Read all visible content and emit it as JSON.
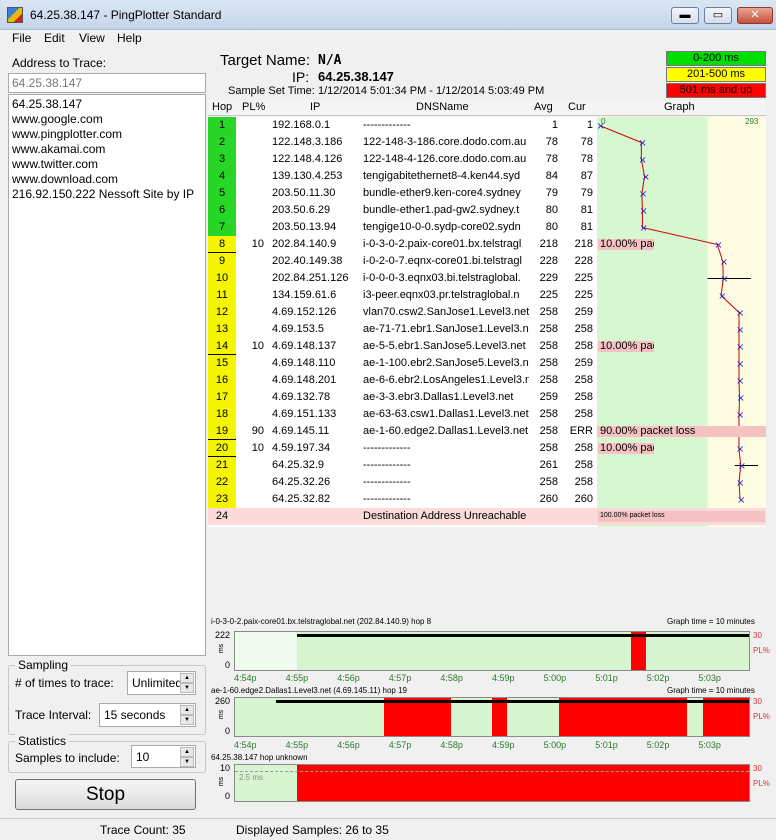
{
  "window": {
    "title": "64.25.38.147 - PingPlotter Standard",
    "minimize": "▬",
    "maximize": "▭",
    "close": "✕"
  },
  "menu": [
    "File",
    "Edit",
    "View",
    "Help"
  ],
  "address": {
    "label": "Address to Trace:",
    "input_value": "64.25.38.147",
    "list": [
      "64.25.38.147",
      "www.google.com",
      "www.pingplotter.com",
      "www.akamai.com",
      "www.twitter.com",
      "www.download.com",
      "216.92.150.222 Nessoft Site by IP"
    ]
  },
  "sampling": {
    "title": "Sampling",
    "times_label": "# of times to trace:",
    "times_value": "Unlimited",
    "interval_label": "Trace Interval:",
    "interval_value": "15 seconds"
  },
  "statistics": {
    "title": "Statistics",
    "samples_label": "Samples to include:",
    "samples_value": "10"
  },
  "stop_label": "Stop",
  "status": {
    "trace_count": "Trace Count: 35",
    "displayed": "Displayed Samples: 26 to 35"
  },
  "header": {
    "target_name_label": "Target Name:",
    "target_name": "N/A",
    "ip_label": "IP:",
    "ip": "64.25.38.147",
    "sample_label": "Sample Set Time:",
    "sample_value": "1/12/2014 5:01:34 PM - 1/12/2014 5:03:49 PM"
  },
  "legend": [
    {
      "label": "0-200 ms",
      "color": "#00dd00"
    },
    {
      "label": "201-500 ms",
      "color": "#ffff00"
    },
    {
      "label": "501 ms and up",
      "color": "#ff0000"
    }
  ],
  "columns": {
    "hop": "Hop",
    "pl": "PL%",
    "ip": "IP",
    "dns": "DNSName",
    "avg": "Avg",
    "cur": "Cur",
    "graph": "Graph"
  },
  "graph_scale": {
    "min": "0",
    "max": "293"
  },
  "colors": {
    "hop_green": "#27d627",
    "hop_yellow": "#f5f500",
    "graph_green": "#d6f7d0",
    "graph_yellow": "#fefde2",
    "loss_bar": "#f4c2c2"
  },
  "hops": [
    {
      "hop": "1",
      "pl": "",
      "ip": "192.168.0.1",
      "dns": "-------------",
      "avg": "1",
      "cur": "1",
      "color": "green"
    },
    {
      "hop": "2",
      "pl": "",
      "ip": "122.148.3.186",
      "dns": "122-148-3-186.core.dodo.com.au",
      "avg": "78",
      "cur": "78",
      "color": "green"
    },
    {
      "hop": "3",
      "pl": "",
      "ip": "122.148.4.126",
      "dns": "122-148-4-126.core.dodo.com.au",
      "avg": "78",
      "cur": "78",
      "color": "green"
    },
    {
      "hop": "4",
      "pl": "",
      "ip": "139.130.4.253",
      "dns": "tengigabitethernet8-4.ken44.syd",
      "avg": "84",
      "cur": "87",
      "color": "green"
    },
    {
      "hop": "5",
      "pl": "",
      "ip": "203.50.11.30",
      "dns": "bundle-ether9.ken-core4.sydney",
      "avg": "79",
      "cur": "79",
      "color": "green"
    },
    {
      "hop": "6",
      "pl": "",
      "ip": "203.50.6.29",
      "dns": "bundle-ether1.pad-gw2.sydney.t",
      "avg": "80",
      "cur": "81",
      "color": "green"
    },
    {
      "hop": "7",
      "pl": "",
      "ip": "203.50.13.94",
      "dns": "tengige10-0-0.sydp-core02.sydn",
      "avg": "80",
      "cur": "81",
      "color": "green"
    },
    {
      "hop": "8",
      "pl": "10",
      "ip": "202.84.140.9",
      "dns": "i-0-3-0-2.paix-core01.bx.telstragl",
      "avg": "218",
      "cur": "218",
      "color": "yellow",
      "loss": "10.00% packet loss"
    },
    {
      "hop": "9",
      "pl": "",
      "ip": "202.40.149.38",
      "dns": "i-0-2-0-7.eqnx-core01.bi.telstragl",
      "avg": "228",
      "cur": "228",
      "color": "yellow"
    },
    {
      "hop": "10",
      "pl": "",
      "ip": "202.84.251.126",
      "dns": "i-0-0-0-3.eqnx03.bi.telstraglobal.",
      "avg": "229",
      "cur": "225",
      "color": "yellow"
    },
    {
      "hop": "11",
      "pl": "",
      "ip": "134.159.61.6",
      "dns": "i3-peer.eqnx03.pr.telstraglobal.n",
      "avg": "225",
      "cur": "225",
      "color": "yellow"
    },
    {
      "hop": "12",
      "pl": "",
      "ip": "4.69.152.126",
      "dns": "vlan70.csw2.SanJose1.Level3.net",
      "avg": "258",
      "cur": "259",
      "color": "yellow"
    },
    {
      "hop": "13",
      "pl": "",
      "ip": "4.69.153.5",
      "dns": "ae-71-71.ebr1.SanJose1.Level3.ne",
      "avg": "258",
      "cur": "258",
      "color": "yellow"
    },
    {
      "hop": "14",
      "pl": "10",
      "ip": "4.69.148.137",
      "dns": "ae-5-5.ebr1.SanJose5.Level3.net",
      "avg": "258",
      "cur": "258",
      "color": "yellow",
      "loss": "10.00% packet loss"
    },
    {
      "hop": "15",
      "pl": "",
      "ip": "4.69.148.110",
      "dns": "ae-1-100.ebr2.SanJose5.Level3.ne",
      "avg": "258",
      "cur": "259",
      "color": "yellow"
    },
    {
      "hop": "16",
      "pl": "",
      "ip": "4.69.148.201",
      "dns": "ae-6-6.ebr2.LosAngeles1.Level3.n",
      "avg": "258",
      "cur": "258",
      "color": "yellow"
    },
    {
      "hop": "17",
      "pl": "",
      "ip": "4.69.132.78",
      "dns": "ae-3-3.ebr3.Dallas1.Level3.net",
      "avg": "259",
      "cur": "258",
      "color": "yellow"
    },
    {
      "hop": "18",
      "pl": "",
      "ip": "4.69.151.133",
      "dns": "ae-63-63.csw1.Dallas1.Level3.net",
      "avg": "258",
      "cur": "258",
      "color": "yellow"
    },
    {
      "hop": "19",
      "pl": "90",
      "ip": "4.69.145.11",
      "dns": "ae-1-60.edge2.Dallas1.Level3.net",
      "avg": "258",
      "cur": "ERR",
      "color": "yellow",
      "loss": "90.00% packet loss"
    },
    {
      "hop": "20",
      "pl": "10",
      "ip": "4.59.197.34",
      "dns": "-------------",
      "avg": "258",
      "cur": "258",
      "color": "yellow",
      "loss": "10.00% packet loss"
    },
    {
      "hop": "21",
      "pl": "",
      "ip": "64.25.32.9",
      "dns": "-------------",
      "avg": "261",
      "cur": "258",
      "color": "yellow"
    },
    {
      "hop": "22",
      "pl": "",
      "ip": "64.25.32.26",
      "dns": "-------------",
      "avg": "258",
      "cur": "258",
      "color": "yellow"
    },
    {
      "hop": "23",
      "pl": "",
      "ip": "64.25.32.82",
      "dns": "-------------",
      "avg": "260",
      "cur": "260",
      "color": "yellow"
    }
  ],
  "unreachable": {
    "hop": "24",
    "text": "Destination Address Unreachable",
    "loss": "100.00% packet loss"
  },
  "time_graphs": [
    {
      "title": "i-0-3-0-2.paix-core01.bx.telstraglobal.net (202.84.140.9) hop 8",
      "graph_time": "Graph time = 10 minutes",
      "y_top": "222",
      "y_bottom": "0",
      "right_top": "30",
      "right_label": "PL%",
      "ms": "ms",
      "times": [
        "4:54p",
        "4:55p",
        "4:56p",
        "4:57p",
        "4:58p",
        "4:59p",
        "5:00p",
        "5:01p",
        "5:02p",
        "5:03p"
      ]
    },
    {
      "title": "ae-1-60.edge2.Dallas1.Level3.net (4.69.145.11) hop 19",
      "graph_time": "Graph time = 10 minutes",
      "y_top": "260",
      "y_bottom": "0",
      "right_top": "30",
      "right_label": "PL%",
      "ms": "ms",
      "times": [
        "4:54p",
        "4:55p",
        "4:56p",
        "4:57p",
        "4:58p",
        "4:59p",
        "5:00p",
        "5:01p",
        "5:02p",
        "5:03p"
      ]
    },
    {
      "title": "64.25.38.147 hop unknown",
      "graph_time": "",
      "y_top": "10",
      "y_bottom": "0",
      "right_top": "30",
      "right_label": "PL%",
      "ms": "ms",
      "dash_label": "2.5 ms",
      "times": [
        "4:54p",
        "4:55p",
        "4:56p",
        "4:57p",
        "4:58p",
        "4:59p",
        "5:00p",
        "5:01p",
        "5:02p",
        "5:03p"
      ]
    }
  ]
}
